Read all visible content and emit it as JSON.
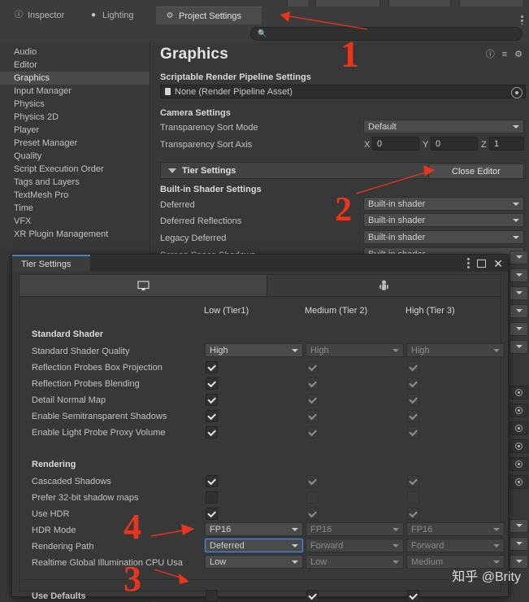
{
  "window": {
    "tabs": [
      {
        "label": "Inspector",
        "icon": "info-icon",
        "active": false
      },
      {
        "label": "Lighting",
        "icon": "lightbulb-icon",
        "active": false
      },
      {
        "label": "Project Settings",
        "icon": "gear-icon",
        "active": true
      }
    ],
    "menu_icon": "kebab-menu-icon"
  },
  "search": {
    "value": "",
    "placeholder": "",
    "icon": "search-icon"
  },
  "sidebar": {
    "items": [
      {
        "label": "Audio",
        "selected": false
      },
      {
        "label": "Editor",
        "selected": false
      },
      {
        "label": "Graphics",
        "selected": true
      },
      {
        "label": "Input Manager",
        "selected": false
      },
      {
        "label": "Physics",
        "selected": false
      },
      {
        "label": "Physics 2D",
        "selected": false
      },
      {
        "label": "Player",
        "selected": false
      },
      {
        "label": "Preset Manager",
        "selected": false
      },
      {
        "label": "Quality",
        "selected": false
      },
      {
        "label": "Script Execution Order",
        "selected": false
      },
      {
        "label": "Tags and Layers",
        "selected": false
      },
      {
        "label": "TextMesh Pro",
        "selected": false
      },
      {
        "label": "Time",
        "selected": false
      },
      {
        "label": "VFX",
        "selected": false
      },
      {
        "label": "XR Plugin Management",
        "selected": false
      }
    ]
  },
  "graphics": {
    "title": "Graphics",
    "header_icons": [
      "help-icon",
      "preset-icon",
      "gear-icon"
    ],
    "srp_section": "Scriptable Render Pipeline Settings",
    "srp_value": "None (Render Pipeline Asset)",
    "camera_section": "Camera Settings",
    "sort_mode_label": "Transparency Sort Mode",
    "sort_mode_value": "Default",
    "sort_axis_label": "Transparency Sort Axis",
    "axis_x_label": "X",
    "axis_x_value": "0",
    "axis_y_label": "Y",
    "axis_y_value": "0",
    "axis_z_label": "Z",
    "axis_z_value": "1",
    "tier_fold_label": "Tier Settings",
    "close_editor_label": "Close Editor",
    "builtin_section": "Built-in Shader Settings",
    "builtin_rows": [
      {
        "label": "Deferred",
        "value": "Built-in shader"
      },
      {
        "label": "Deferred Reflections",
        "value": "Built-in shader"
      },
      {
        "label": "Legacy Deferred",
        "value": "Built-in shader"
      },
      {
        "label": "Screen Space Shadows",
        "value": "Built-in shader"
      }
    ]
  },
  "tier_window": {
    "title": "Tier Settings",
    "controls": [
      "kebab-menu-icon",
      "maximize-icon",
      "close-icon"
    ],
    "platform_tabs": [
      {
        "icon": "desktop-monitor-icon",
        "active": true
      },
      {
        "icon": "android-robot-icon",
        "active": false
      }
    ],
    "columns": [
      "Low (Tier1)",
      "Medium (Tier 2)",
      "High (Tier 3)"
    ],
    "groups": [
      {
        "name": "Standard Shader",
        "rows": [
          {
            "label": "Standard Shader Quality",
            "type": "dropdown",
            "values": [
              "High",
              "High",
              "High"
            ]
          },
          {
            "label": "Reflection Probes Box Projection",
            "type": "checkbox",
            "values": [
              true,
              true,
              true
            ]
          },
          {
            "label": "Reflection Probes Blending",
            "type": "checkbox",
            "values": [
              true,
              true,
              true
            ]
          },
          {
            "label": "Detail Normal Map",
            "type": "checkbox",
            "values": [
              true,
              true,
              true
            ]
          },
          {
            "label": "Enable Semitransparent Shadows",
            "type": "checkbox",
            "values": [
              true,
              true,
              true
            ]
          },
          {
            "label": "Enable Light Probe Proxy Volume",
            "type": "checkbox",
            "values": [
              true,
              true,
              true
            ]
          }
        ]
      },
      {
        "name": "Rendering",
        "rows": [
          {
            "label": "Cascaded Shadows",
            "type": "checkbox",
            "values": [
              true,
              true,
              true
            ]
          },
          {
            "label": "Prefer 32-bit shadow maps",
            "type": "checkbox",
            "values": [
              false,
              false,
              false
            ]
          },
          {
            "label": "Use HDR",
            "type": "checkbox",
            "values": [
              true,
              true,
              true
            ]
          },
          {
            "label": "HDR Mode",
            "type": "dropdown",
            "values": [
              "FP16",
              "FP16",
              "FP16"
            ]
          },
          {
            "label": "Rendering Path",
            "type": "dropdown",
            "values": [
              "Deferred",
              "Forward",
              "Forward"
            ],
            "focused": 0
          },
          {
            "label": "Realtime Global Illumination CPU Usa",
            "type": "dropdown",
            "values": [
              "Low",
              "Low",
              "Medium"
            ]
          }
        ]
      }
    ],
    "defaults_label": "Use Defaults",
    "defaults_values": [
      false,
      true,
      true
    ]
  },
  "annotations": {
    "markers": [
      {
        "text": "1"
      },
      {
        "text": "2"
      },
      {
        "text": "3"
      },
      {
        "text": "4"
      }
    ],
    "color": "#e8361c"
  },
  "watermark": {
    "text": "知乎 @Brity"
  }
}
